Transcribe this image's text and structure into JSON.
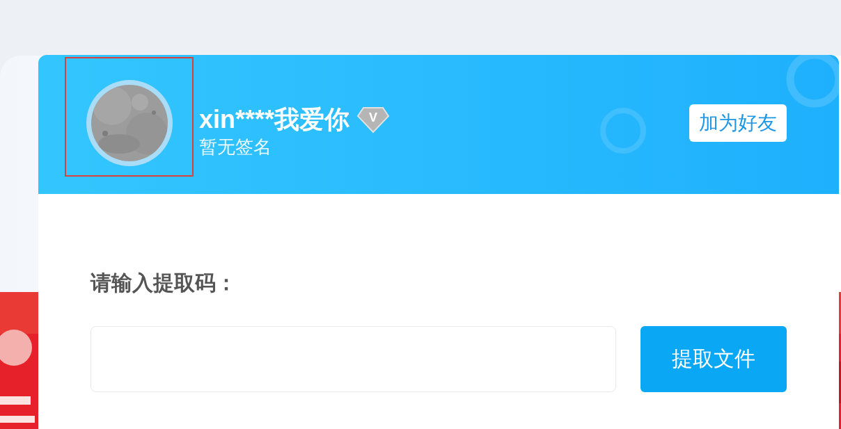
{
  "profile": {
    "avatar": {
      "kind": "picture",
      "highlighted": true
    },
    "name": "xin****我爱你",
    "badge": "V",
    "signature": "暂无签名",
    "add_friend_button": "加为好友"
  },
  "extract": {
    "label": "请输入提取码：",
    "button": "提取文件"
  }
}
